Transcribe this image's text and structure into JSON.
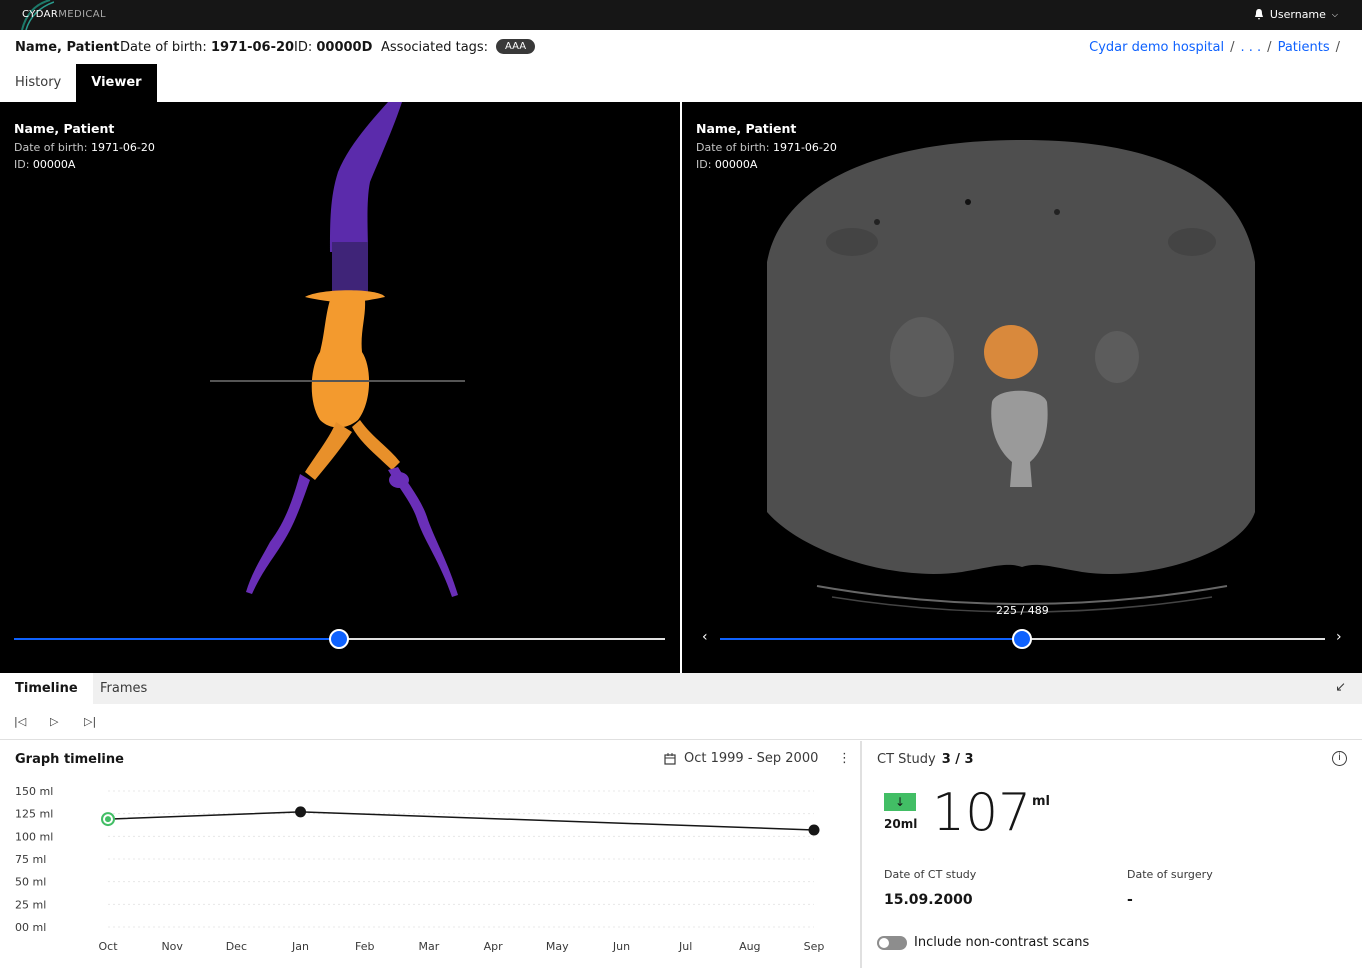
{
  "header": {
    "logo_bold": "CYDAR",
    "logo_light": "MEDICAL",
    "username": "Username"
  },
  "patient": {
    "name": "Name, Patient",
    "dob_label": "Date of birth:",
    "dob": "1971-06-20",
    "id_label": "ID:",
    "id": "00000D",
    "tags_label": "Associated tags:",
    "tag": "AAA"
  },
  "breadcrumb": {
    "items": [
      "Cydar demo hospital",
      ". . .",
      "Patients"
    ],
    "sep": "/"
  },
  "tabs": [
    {
      "label": "History"
    },
    {
      "label": "Viewer"
    }
  ],
  "viewer_left": {
    "name": "Name, Patient",
    "dob_label": "Date of birth:",
    "dob": "1971-06-20",
    "id_label": "ID:",
    "id": "00000A",
    "slider_fraction": 0.5
  },
  "viewer_right": {
    "name": "Name, Patient",
    "dob_label": "Date of birth:",
    "dob": "1971-06-20",
    "id_label": "ID:",
    "id": "00000A",
    "slice_counter": "225 / 489",
    "slider_fraction": 0.5
  },
  "bottom_tabs": [
    {
      "label": "Timeline"
    },
    {
      "label": "Frames"
    }
  ],
  "graph": {
    "title": "Graph timeline",
    "range": "Oct 1999 - Sep 2000",
    "menu_glyph": "⋮",
    "y_ticks": [
      "150 ml",
      "125 ml",
      "100 ml",
      "75 ml",
      "50 ml",
      "25 ml",
      "00 ml"
    ],
    "x_ticks": [
      "Oct",
      "Nov",
      "Dec",
      "Jan",
      "Feb",
      "Mar",
      "Apr",
      "May",
      "Jun",
      "Jul",
      "Aug",
      "Sep"
    ]
  },
  "chart_data": {
    "type": "line",
    "title": "Graph timeline",
    "x": [
      "Oct",
      "Jan",
      "Sep"
    ],
    "series": [
      {
        "values": [
          119,
          127,
          107
        ]
      }
    ],
    "ylim": [
      0,
      150
    ],
    "y_ticks": [
      0,
      25,
      50,
      75,
      100,
      125,
      150
    ],
    "categories": [
      "Oct",
      "Nov",
      "Dec",
      "Jan",
      "Feb",
      "Mar",
      "Apr",
      "May",
      "Jun",
      "Jul",
      "Aug",
      "Sep"
    ]
  },
  "ct_study": {
    "title": "CT Study",
    "count": "3 / 3",
    "delta_arrow": "↓",
    "delta": "20ml",
    "volume": "107",
    "unit": "ml",
    "date_label": "Date of CT study",
    "date": "15.09.2000",
    "surgery_label": "Date of surgery",
    "surgery": "-",
    "toggle_label": "Include non-contrast scans"
  },
  "colors": {
    "accent": "#0f62fe",
    "aneurysm": "#f39a2e",
    "vessel": "#6a2fb8",
    "delta_green": "#42be65"
  }
}
